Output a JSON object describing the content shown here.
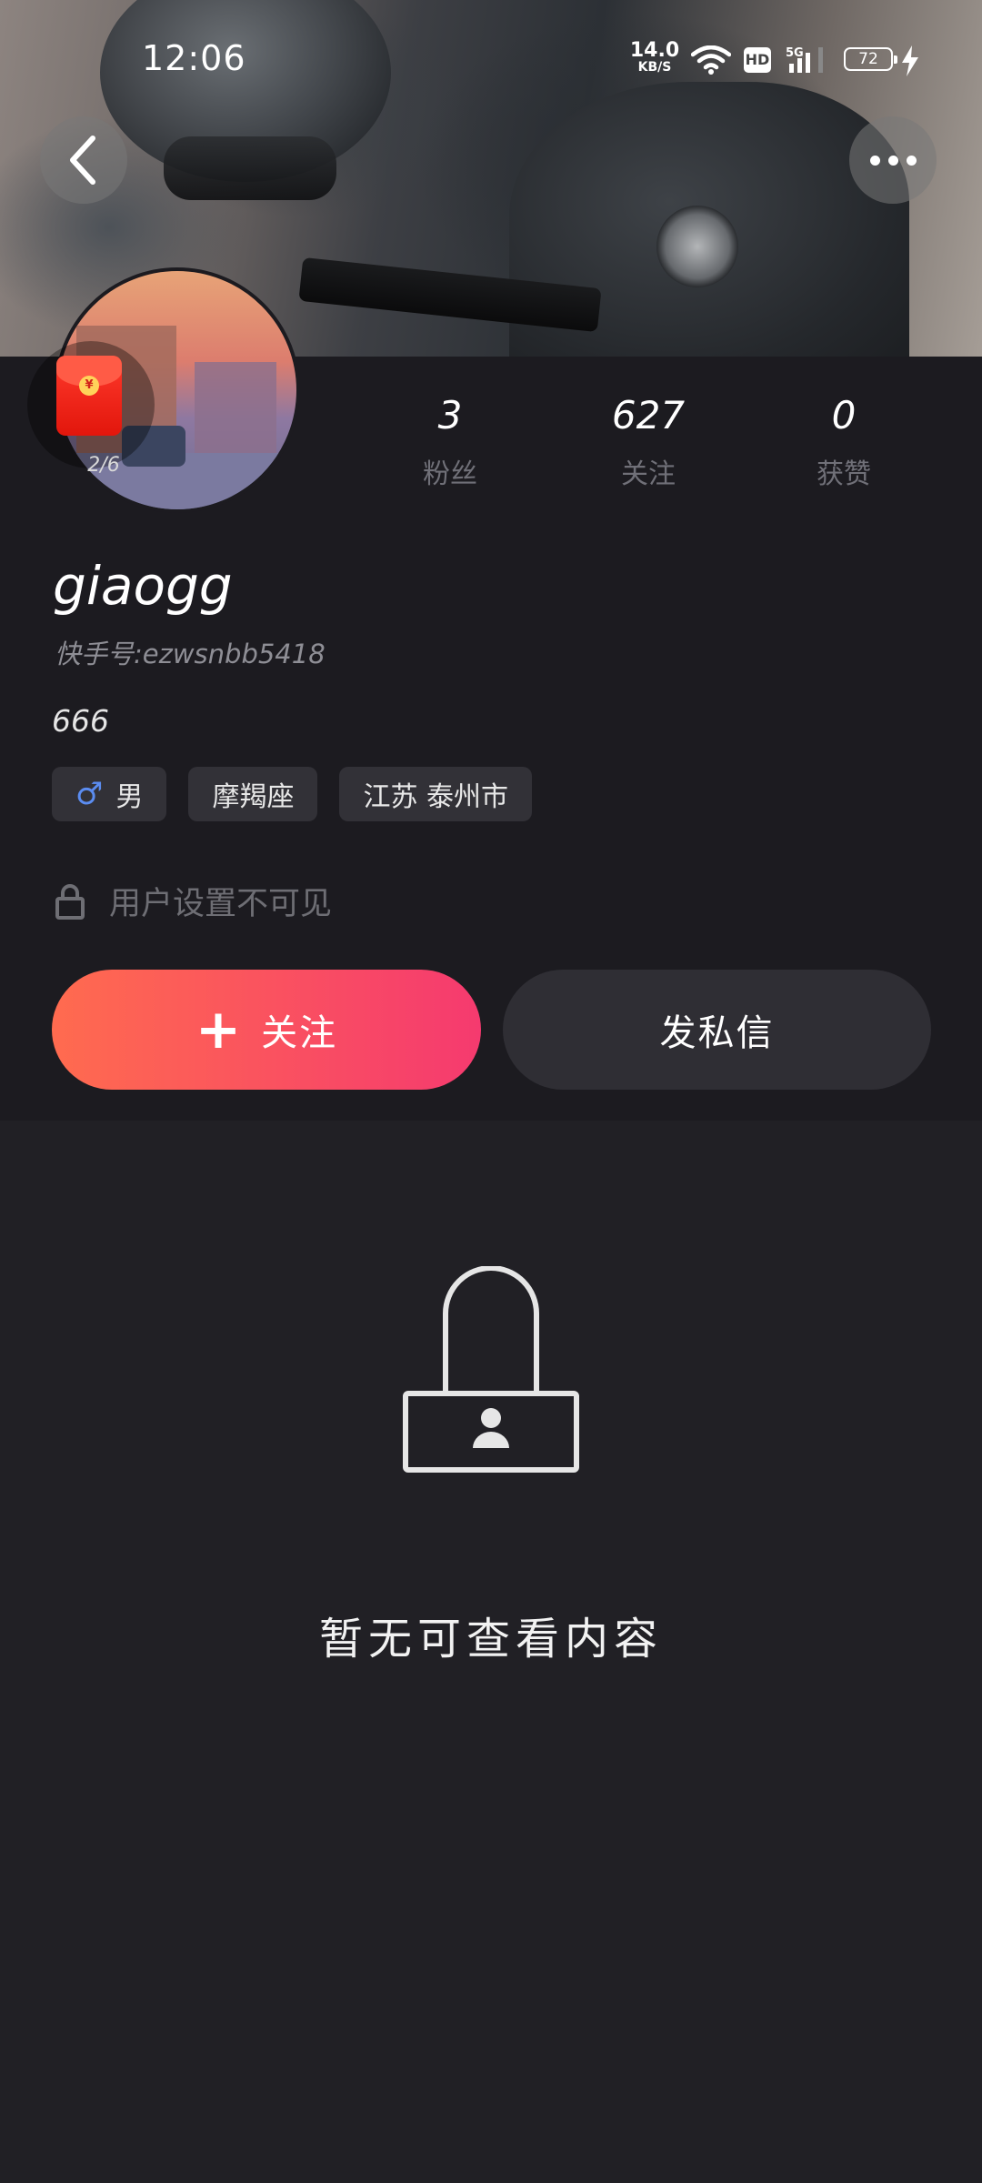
{
  "status_bar": {
    "time": "12:06",
    "net_speed": "14.0",
    "net_unit": "KB/S",
    "hd_badge": "HD",
    "network": "5G",
    "battery": "72"
  },
  "profile": {
    "red_packet_count": "2/6",
    "red_packet_coin": "¥",
    "stats": [
      {
        "value": "3",
        "label": "粉丝"
      },
      {
        "value": "627",
        "label": "关注"
      },
      {
        "value": "0",
        "label": "获赞"
      }
    ],
    "username": "giaogg",
    "user_id": "快手号:ezwsnbb5418",
    "bio": "666",
    "tags": {
      "gender_symbol": "♂",
      "gender": "男",
      "zodiac": "摩羯座",
      "location": "江苏 泰州市"
    },
    "privacy_text": "用户设置不可见",
    "follow_plus": "+",
    "follow_label": "关注",
    "message_label": "发私信"
  },
  "content": {
    "empty_text": "暂无可查看内容"
  },
  "colors": {
    "follow_gradient_start": "#ff6b4f",
    "follow_gradient_end": "#f53a6f",
    "background": "#212025",
    "gender_male": "#5b8cf0"
  }
}
